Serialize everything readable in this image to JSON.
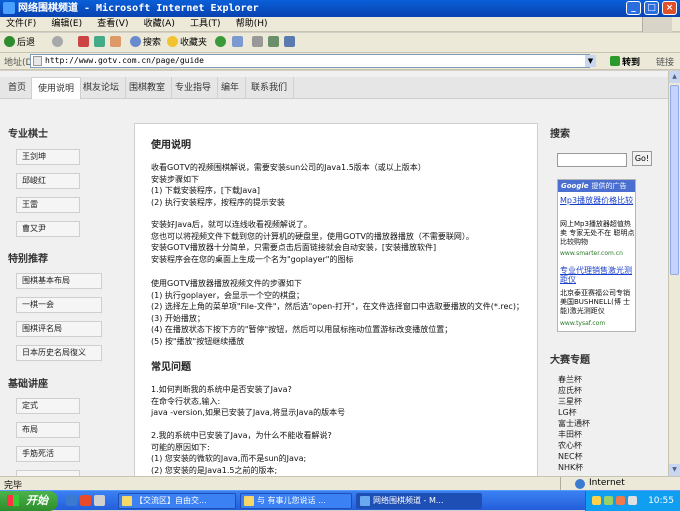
{
  "window": {
    "title": "网络围棋频道 - Microsoft Internet Explorer",
    "minimize": "_",
    "maximize": "□",
    "close": "×"
  },
  "menu": [
    "文件(F)",
    "编辑(E)",
    "查看(V)",
    "收藏(A)",
    "工具(T)",
    "帮助(H)"
  ],
  "toolbar": {
    "back": "后退",
    "search": "搜索",
    "favorites": "收藏夹"
  },
  "address": {
    "label": "地址(D)",
    "url": "http://www.gotv.com.cn/page/guide",
    "go": "转到",
    "links": "链接"
  },
  "nav": {
    "tabs": [
      "首页",
      "使用说明",
      "棋友论坛",
      "围棋教室",
      "专业指导",
      "编年",
      "联系我们"
    ],
    "active_index": 1
  },
  "left": {
    "pro_title": "专业棋士",
    "pros": [
      "王剑坤",
      "邱峻红",
      "王雷",
      "曹又尹"
    ],
    "rec_title": "特别推荐",
    "recs": [
      "围棋基本布局",
      "一棋一会",
      "围棋评名局",
      "日本历史名局復义"
    ],
    "course_title": "基础讲座",
    "courses": [
      "定式",
      "布局",
      "手筋死活",
      ""
    ]
  },
  "main": {
    "heading": "使用说明",
    "para1": [
      "收看GOTV的视频围棋解说，需要安装sun公司的Java1.5版本（或以上版本）",
      "安装步骤如下",
      "(1) 下载安装程序，[下载Java]",
      "(2) 执行安装程序，按程序的提示安装"
    ],
    "para2": [
      "安装好Java后，就可以连线收看视频解说了。",
      "您也可以将视频文件下载到您的计算机的硬盘里，使用GOTV的播放器播放（不需要联网）。",
      "安装GOTV播放器十分简单，只需要点击后面链接就会自动安装，[安装播放软件]",
      "安装程序会在您的桌面上生成一个名为\"goplayer\"的图标"
    ],
    "para3": [
      "使用GOTV播放器播放视频文件的步骤如下",
      "(1) 执行goplayer，会显示一个空的棋盘；",
      "(2) 选择左上角的菜单项\"File-文件\"，然后选\"open-打开\"，在文件选择窗口中选取要播放的文件(*.rec)；",
      "(3) 开始播放；",
      "(4) 在播放状态下按下方的\"暂停\"按钮，然后可以用鼠标拖动位置游标改变播放位置；",
      "(5) 按\"播放\"按钮继续播放"
    ],
    "faq_heading": "常见问题",
    "faq1": [
      "1.如何判断我的系统中是否安装了Java?",
      "在命令行状态,输入:",
      "java -version,如果已安装了Java,将显示Java的版本号"
    ],
    "faq2": [
      "2.我的系统中已安装了Java，为什么不能收看解说?",
      "可能的原因如下:",
      "(1) 您安装的微软的Java,而不是sun的Java;",
      "(2) 您安装的是Java1.5之前的版本;"
    ]
  },
  "right": {
    "search_title": "搜索",
    "search_button": "Go!",
    "ad_brand": "Google",
    "ad_brand_sub": "提供的广告",
    "ads": [
      {
        "title": "Mp3播放器价格比较",
        "desc": "网上Mp3播放器超值热卖 专家无处不在 聪明点比较购物",
        "url": "www.smarter.com.cn"
      },
      {
        "title": "专业代理销售激光测距仪",
        "desc": "北京泰亚赛福公司专销美国BUSHNELL(博 士能)激光测距仪",
        "url": "www.tysaf.com"
      }
    ],
    "events_title": "大赛专题",
    "events": [
      "春兰杯",
      "应氏杯",
      "三星杯",
      "LG杯",
      "富士通杯",
      "丰田杯",
      "农心杯",
      "NEC杯",
      "NHK杯"
    ]
  },
  "status": {
    "text": "完毕",
    "zone": "Internet"
  },
  "taskbar": {
    "start": "开始",
    "tasks": [
      "【交流区】自由交...",
      "与 有事儿您说话 ...",
      "网络围棋频道 - M..."
    ],
    "clock": "10:55"
  }
}
